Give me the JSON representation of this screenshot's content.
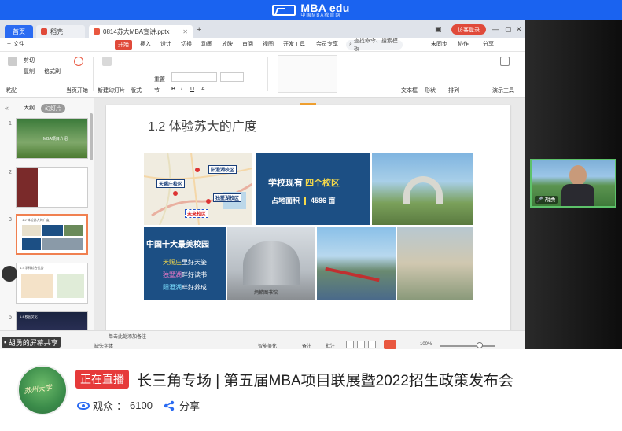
{
  "brand": {
    "name": "MBA edu",
    "tagline": "中国MBA教育网"
  },
  "wps": {
    "tabs": [
      "首页",
      "稻壳",
      "0814苏大MBA宣讲.pptx"
    ],
    "login_button": "访客登录",
    "menu": [
      "三 文件",
      "开始",
      "插入",
      "设计",
      "切换",
      "动画",
      "放映",
      "审阅",
      "视图",
      "开发工具",
      "会员专享"
    ],
    "search_placeholder": "查找命令、搜索模板",
    "menu_right": [
      "未同步",
      "协作",
      "分享"
    ],
    "ribbon": [
      "粘贴",
      "剪切",
      "复制",
      "格式刷",
      "当页开始",
      "新建幻灯片",
      "版式",
      "节",
      "重置",
      "文本框",
      "形状",
      "排列",
      "演示工具"
    ],
    "left_tabs": [
      "大纲",
      "幻灯片"
    ],
    "thumb_titles": [
      "MBA项目介绍",
      "",
      "1.2 体验苏大的广度",
      "1.3 学科综合优势",
      "1.4 校园文化"
    ],
    "notes_placeholder": "单击此处添加备注",
    "status": {
      "missing_font": "缺失字体",
      "smart_beautify": "智能美化",
      "notes": "备注",
      "comment": "批注",
      "zoom": "100%"
    }
  },
  "slide": {
    "title": "1.2 体验苏大的广度",
    "map_labels": [
      "阳澄湖校区",
      "天赐庄校区",
      "独墅湖校区",
      "未来校区"
    ],
    "campus_line1_a": "学校现有",
    "campus_line1_b": "四个校区",
    "campus_line2_a": "占地面积",
    "campus_line2_b": "4586 亩",
    "beauty_heading": "中国十大最美校园",
    "beauty_lines": [
      {
        "hl": "天赐庄",
        "rest": "里好天姿"
      },
      {
        "hl": "独墅湖",
        "rest": "畔好读书"
      },
      {
        "hl": "阳澄湖",
        "rest": "畔好养成"
      }
    ],
    "library_sign": "炳麟图书馆"
  },
  "screen_share_label": "胡勇的屏幕共享",
  "speaker_name": "胡勇",
  "live": {
    "avatar_text": "苏州大学",
    "badge": "正在直播",
    "title": "长三角专场 | 第五届MBA项目联展暨2022招生政策发布会",
    "viewers_label": "观众",
    "viewers_count": "6100",
    "share_label": "分享"
  }
}
